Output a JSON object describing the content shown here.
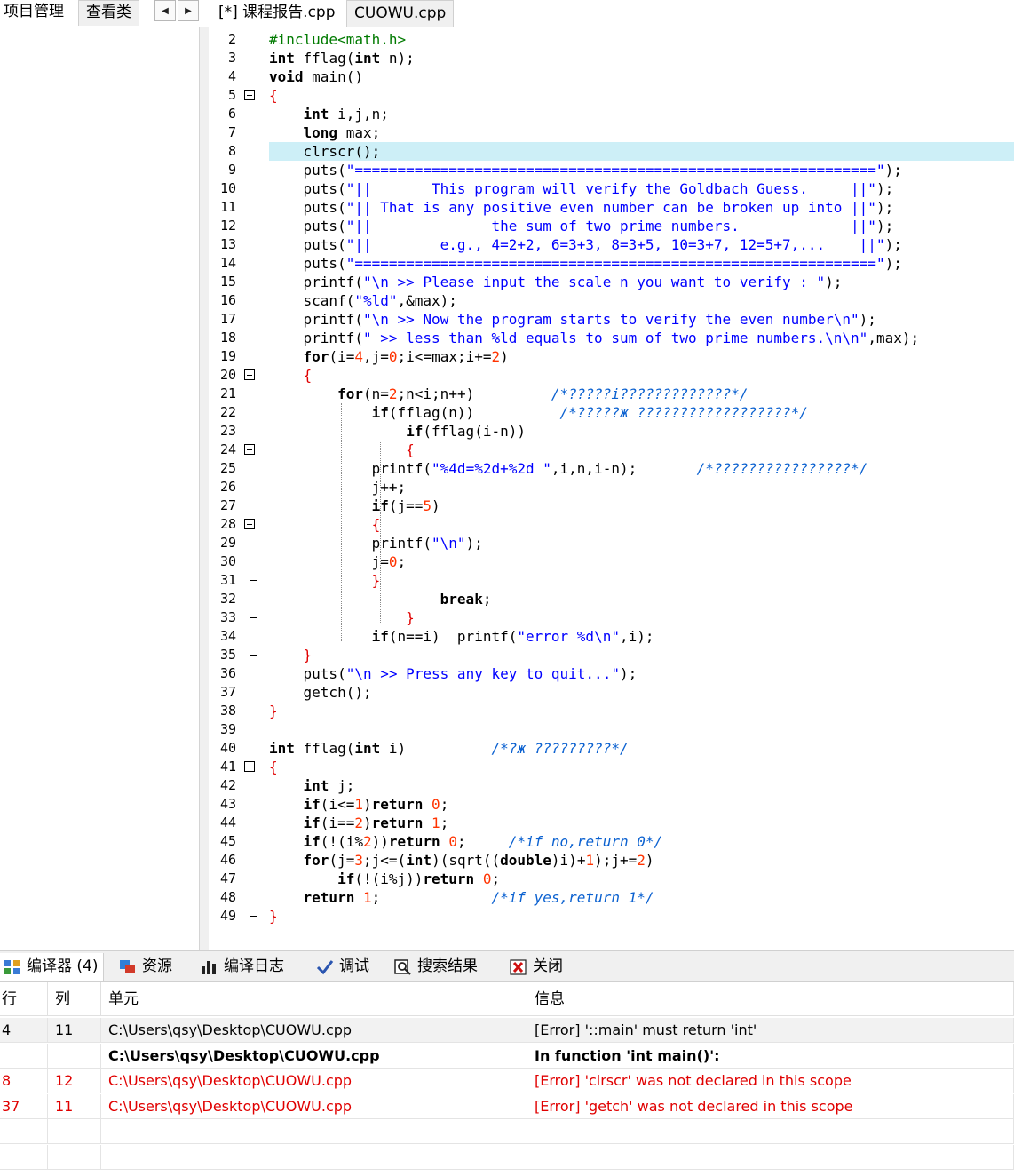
{
  "top_tabs": {
    "project": "项目管理",
    "class_view": "查看类",
    "prev_arrow": "◀",
    "next_arrow": "▶",
    "files": [
      "[*] 课程报告.cpp",
      "CUOWU.cpp"
    ]
  },
  "editor": {
    "highlight_line": 8,
    "lines": [
      {
        "n": "2",
        "html": "<span class=\"pp\">#include&lt;math.h&gt;</span>"
      },
      {
        "n": "3",
        "html": "<span class=\"kw\">int</span> fflag(<span class=\"kw\">int</span> n);"
      },
      {
        "n": "4",
        "html": "<span class=\"kw\">void</span> main()"
      },
      {
        "n": "5",
        "html": "<span class=\"op\">{</span>"
      },
      {
        "n": "6",
        "html": "    <span class=\"kw\">int</span> i,j,n;"
      },
      {
        "n": "7",
        "html": "    <span class=\"kw\">long</span> max;"
      },
      {
        "n": "8",
        "html": "    clrscr();"
      },
      {
        "n": "9",
        "html": "    puts(<span class=\"str\">\"=============================================================\"</span>);"
      },
      {
        "n": "10",
        "html": "    puts(<span class=\"str\">\"||       This program will verify the Goldbach Guess.     ||\"</span>);"
      },
      {
        "n": "11",
        "html": "    puts(<span class=\"str\">\"|| That is any positive even number can be broken up into ||\"</span>);"
      },
      {
        "n": "12",
        "html": "    puts(<span class=\"str\">\"||              the sum of two prime numbers.             ||\"</span>);"
      },
      {
        "n": "13",
        "html": "    puts(<span class=\"str\">\"||        e.g., 4=2+2, 6=3+3, 8=3+5, 10=3+7, 12=5+7,...    ||\"</span>);"
      },
      {
        "n": "14",
        "html": "    puts(<span class=\"str\">\"=============================================================\"</span>);"
      },
      {
        "n": "15",
        "html": "    printf(<span class=\"str\">\"\\n &gt;&gt; Please input the scale n you want to verify : \"</span>);"
      },
      {
        "n": "16",
        "html": "    scanf(<span class=\"str\">\"%ld\"</span>,&amp;max);"
      },
      {
        "n": "17",
        "html": "    printf(<span class=\"str\">\"\\n &gt;&gt; Now the program starts to verify the even number\\n\"</span>);"
      },
      {
        "n": "18",
        "html": "    printf(<span class=\"str\">\" &gt;&gt; less than %ld equals to sum of two prime numbers.\\n\\n\"</span>,max);"
      },
      {
        "n": "19",
        "html": "    <span class=\"kw\">for</span>(i=<span class=\"num\">4</span>,j=<span class=\"num\">0</span>;i&lt;=max;i+=<span class=\"num\">2</span>)"
      },
      {
        "n": "20",
        "html": "    <span class=\"op\">{</span>"
      },
      {
        "n": "21",
        "html": "        <span class=\"kw\">for</span>(n=<span class=\"num\">2</span>;n&lt;i;n++)         <span class=\"cmt\">/*?????i?????????????*/</span>"
      },
      {
        "n": "22",
        "html": "            <span class=\"kw\">if</span>(fflag(n))          <span class=\"cmt\">/*?????ж ??????????????????*/</span>"
      },
      {
        "n": "23",
        "html": "                <span class=\"kw\">if</span>(fflag(i-n))"
      },
      {
        "n": "24",
        "html": "                <span class=\"op\">{</span>"
      },
      {
        "n": "25",
        "html": "            printf(<span class=\"str\">\"%4d=%2d+%2d \"</span>,i,n,i-n);       <span class=\"cmt\">/*????????????????*/</span>"
      },
      {
        "n": "26",
        "html": "            j++;"
      },
      {
        "n": "27",
        "html": "            <span class=\"kw\">if</span>(j==<span class=\"num\">5</span>)"
      },
      {
        "n": "28",
        "html": "            <span class=\"op\">{</span>"
      },
      {
        "n": "29",
        "html": "            printf(<span class=\"str\">\"\\n\"</span>);"
      },
      {
        "n": "30",
        "html": "            j=<span class=\"num\">0</span>;"
      },
      {
        "n": "31",
        "html": "            <span class=\"op\">}</span>"
      },
      {
        "n": "32",
        "html": "                    <span class=\"kw\">break</span>;"
      },
      {
        "n": "33",
        "html": "                <span class=\"op\">}</span>"
      },
      {
        "n": "34",
        "html": "            <span class=\"kw\">if</span>(n==i)  printf(<span class=\"str\">\"error %d\\n\"</span>,i);"
      },
      {
        "n": "35",
        "html": "    <span class=\"op\">}</span>"
      },
      {
        "n": "36",
        "html": "    puts(<span class=\"str\">\"\\n &gt;&gt; Press any key to quit...\"</span>);"
      },
      {
        "n": "37",
        "html": "    getch();"
      },
      {
        "n": "38",
        "html": "<span class=\"op\">}</span>"
      },
      {
        "n": "39",
        "html": ""
      },
      {
        "n": "40",
        "html": "<span class=\"kw\">int</span> fflag(<span class=\"kw\">int</span> i)          <span class=\"cmt\">/*?ж ?????????*/</span>"
      },
      {
        "n": "41",
        "html": "<span class=\"op\">{</span>"
      },
      {
        "n": "42",
        "html": "    <span class=\"kw\">int</span> j;"
      },
      {
        "n": "43",
        "html": "    <span class=\"kw\">if</span>(i&lt;=<span class=\"num\">1</span>)<span class=\"kw\">return</span> <span class=\"num\">0</span>;"
      },
      {
        "n": "44",
        "html": "    <span class=\"kw\">if</span>(i==<span class=\"num\">2</span>)<span class=\"kw\">return</span> <span class=\"num\">1</span>;"
      },
      {
        "n": "45",
        "html": "    <span class=\"kw\">if</span>(!(i%<span class=\"num\">2</span>))<span class=\"kw\">return</span> <span class=\"num\">0</span>;     <span class=\"cmt\">/*if no,return 0*/</span>"
      },
      {
        "n": "46",
        "html": "    <span class=\"kw\">for</span>(j=<span class=\"num\">3</span>;j&lt;=(<span class=\"kw\">int</span>)(sqrt((<span class=\"kw\">double</span>)i)+<span class=\"num\">1</span>);j+=<span class=\"num\">2</span>)"
      },
      {
        "n": "47",
        "html": "        <span class=\"kw\">if</span>(!(i%j))<span class=\"kw\">return</span> <span class=\"num\">0</span>;"
      },
      {
        "n": "48",
        "html": "    <span class=\"kw\">return</span> <span class=\"num\">1</span>;             <span class=\"cmt\">/*if yes,return 1*/</span>"
      },
      {
        "n": "49",
        "html": "<span class=\"op\">}</span>"
      }
    ]
  },
  "bottom_tabs": [
    {
      "label": "编译器 (4)",
      "icon": "compiler-grid-icon"
    },
    {
      "label": "资源",
      "icon": "resources-icon"
    },
    {
      "label": "编译日志",
      "icon": "compile-log-bar-icon"
    },
    {
      "label": "调试",
      "icon": "debug-check-icon"
    },
    {
      "label": "搜索结果",
      "icon": "search-results-icon"
    },
    {
      "label": "关闭",
      "icon": "close-red-icon"
    }
  ],
  "messages": {
    "headers": [
      "行",
      "列",
      "单元",
      "信息"
    ],
    "rows": [
      {
        "line": "4",
        "col": "11",
        "unit": "C:\\Users\\qsy\\Desktop\\CUOWU.cpp",
        "info": "[Error] '::main' must return 'int'",
        "style": "sel"
      },
      {
        "line": "",
        "col": "",
        "unit": "C:\\Users\\qsy\\Desktop\\CUOWU.cpp",
        "info": "In function 'int main()':",
        "style": "bold"
      },
      {
        "line": "8",
        "col": "12",
        "unit": "C:\\Users\\qsy\\Desktop\\CUOWU.cpp",
        "info": "[Error] 'clrscr' was not declared in this scope",
        "style": "red"
      },
      {
        "line": "37",
        "col": "11",
        "unit": "C:\\Users\\qsy\\Desktop\\CUOWU.cpp",
        "info": "[Error] 'getch' was not declared in this scope",
        "style": "red"
      },
      {
        "line": "",
        "col": "",
        "unit": "",
        "info": "",
        "style": ""
      },
      {
        "line": "",
        "col": "",
        "unit": "",
        "info": "",
        "style": ""
      }
    ]
  },
  "colors": {
    "highlight_line": "#cdeff7",
    "error_red": "#e00000",
    "string_blue": "#0000ff",
    "comment_blue": "#0b61d0"
  }
}
